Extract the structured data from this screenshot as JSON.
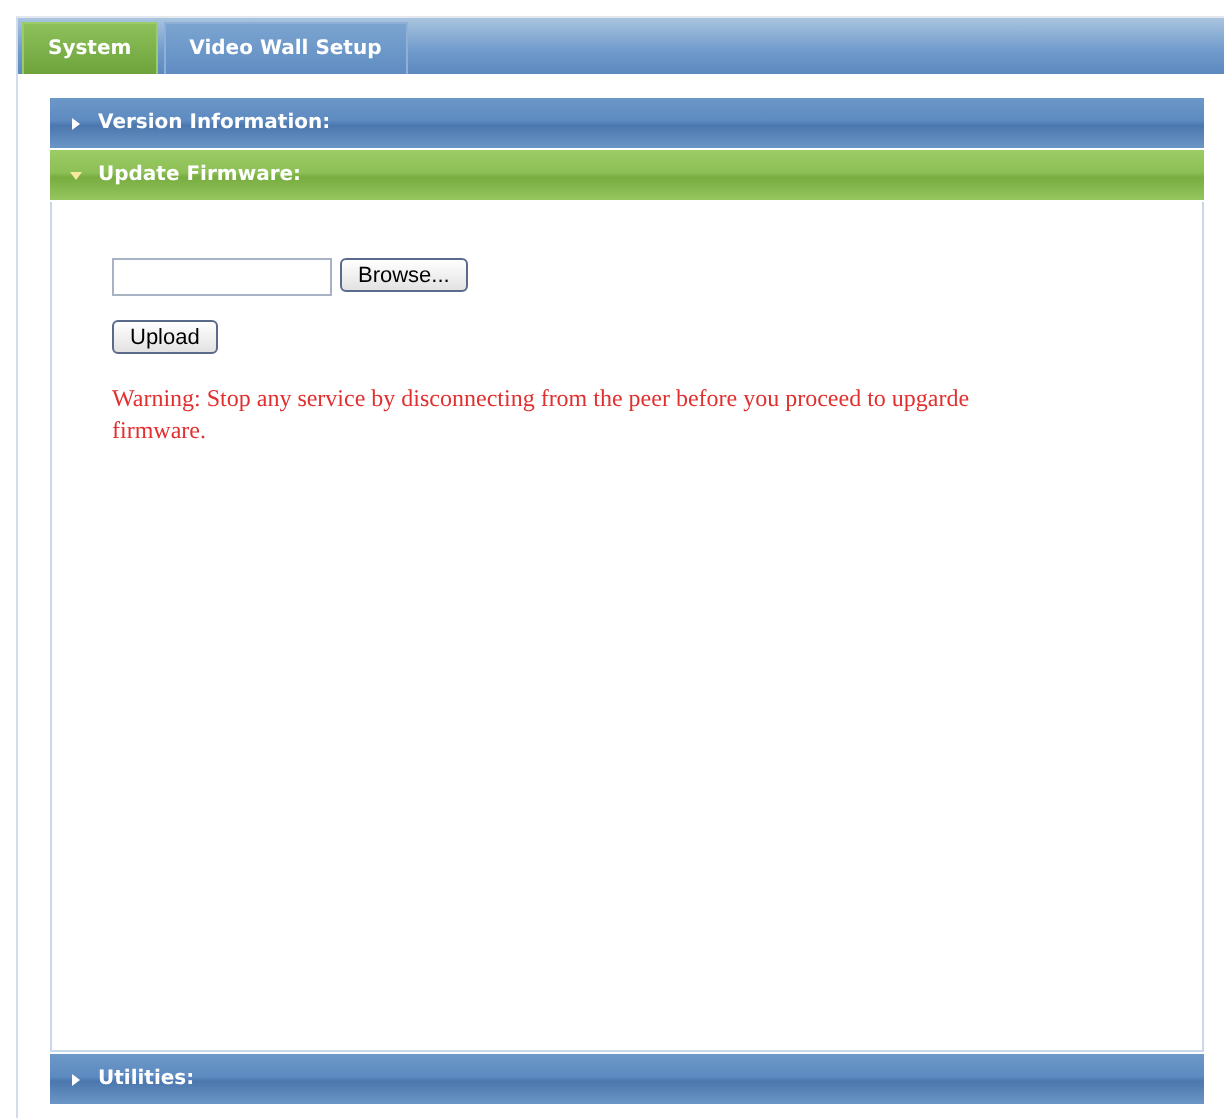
{
  "tabs": [
    {
      "label": "System",
      "selected": true
    },
    {
      "label": "Video Wall Setup",
      "selected": false
    }
  ],
  "sections": [
    {
      "title": "Version Information:",
      "expanded": false
    },
    {
      "title": "Update Firmware:",
      "expanded": true
    },
    {
      "title": "Utilities:",
      "expanded": false
    }
  ],
  "firmware": {
    "browse_button": "Browse...",
    "upload_button": "Upload",
    "warning": "Warning: Stop any service by disconnecting from the peer before you proceed to upgarde firmware."
  }
}
